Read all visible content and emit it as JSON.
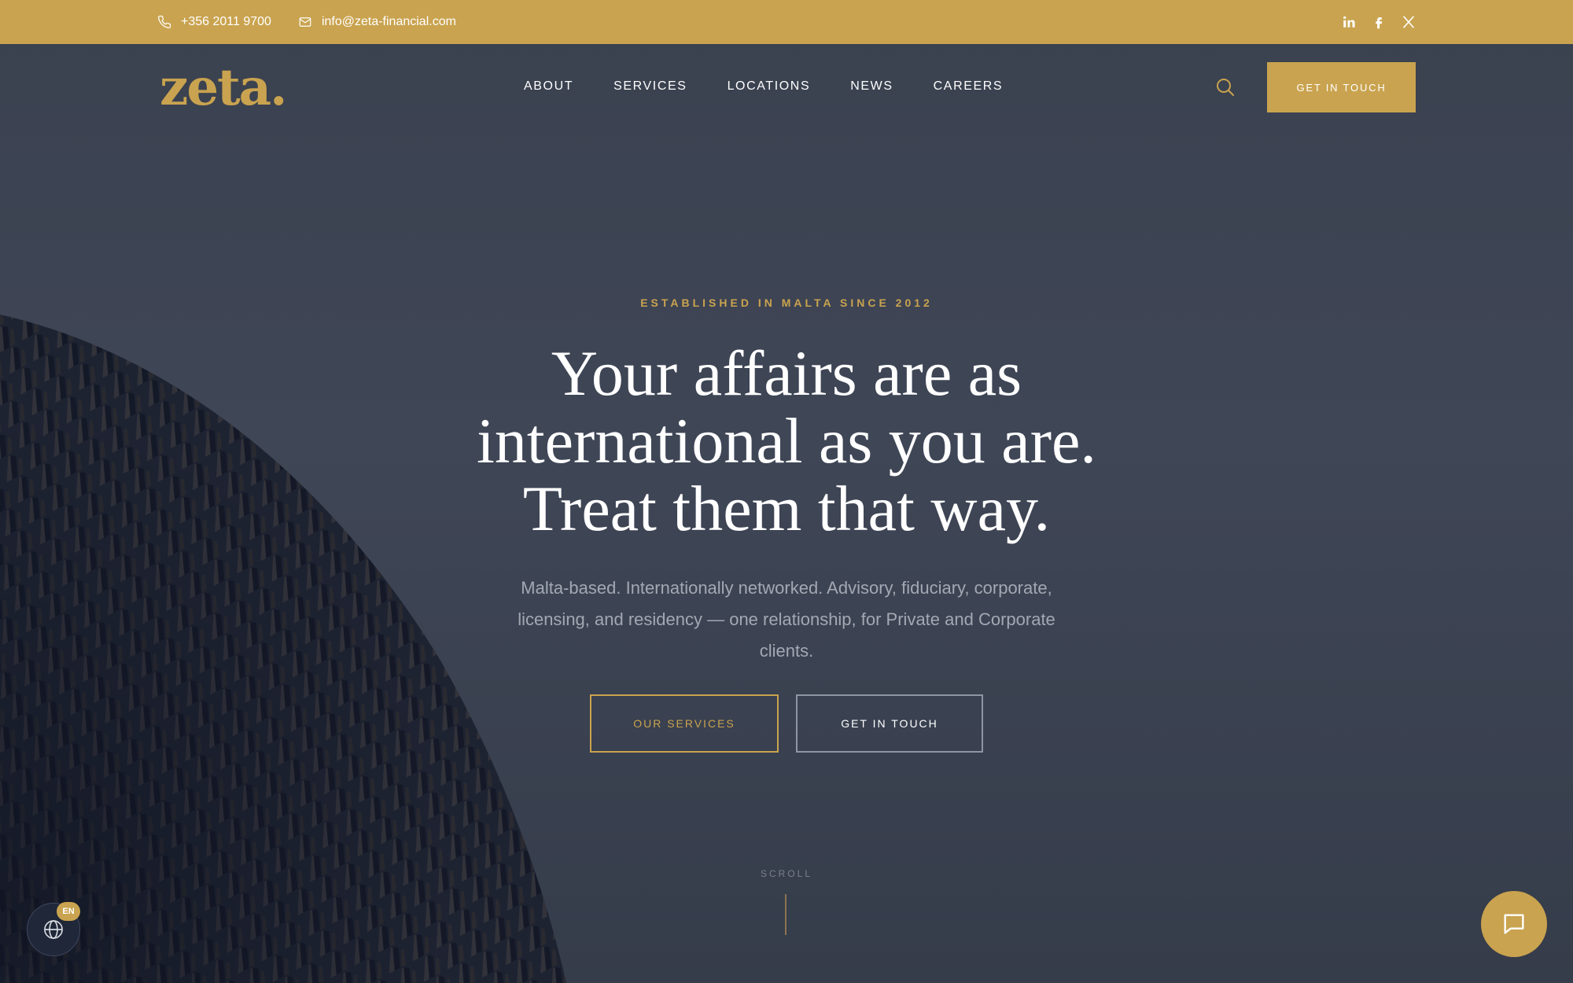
{
  "topbar": {
    "phone": "+356 2011 9700",
    "email": "info@zeta-financial.com",
    "social": [
      "linkedin-icon",
      "facebook-icon",
      "x-icon"
    ]
  },
  "header": {
    "logo": "zeta.",
    "nav": [
      "ABOUT",
      "SERVICES",
      "LOCATIONS",
      "NEWS",
      "CAREERS"
    ],
    "cta": "GET IN TOUCH"
  },
  "hero": {
    "eyebrow": "ESTABLISHED IN MALTA SINCE 2012",
    "title_lines": [
      "Your affairs are as",
      "international as you are.",
      "Treat them that way."
    ],
    "subtitle": "Malta-based. Internationally networked. Advisory, fiduciary, corporate, licensing, and residency — one relationship, for Private and Corporate clients.",
    "primary_button": "OUR SERVICES",
    "secondary_button": "GET IN TOUCH",
    "scroll": "SCROLL"
  },
  "widgets": {
    "language": "EN"
  },
  "colors": {
    "accent": "#c9a34f",
    "background": "#3b4250",
    "text": "#ffffff",
    "muted": "#a3a8b3"
  }
}
